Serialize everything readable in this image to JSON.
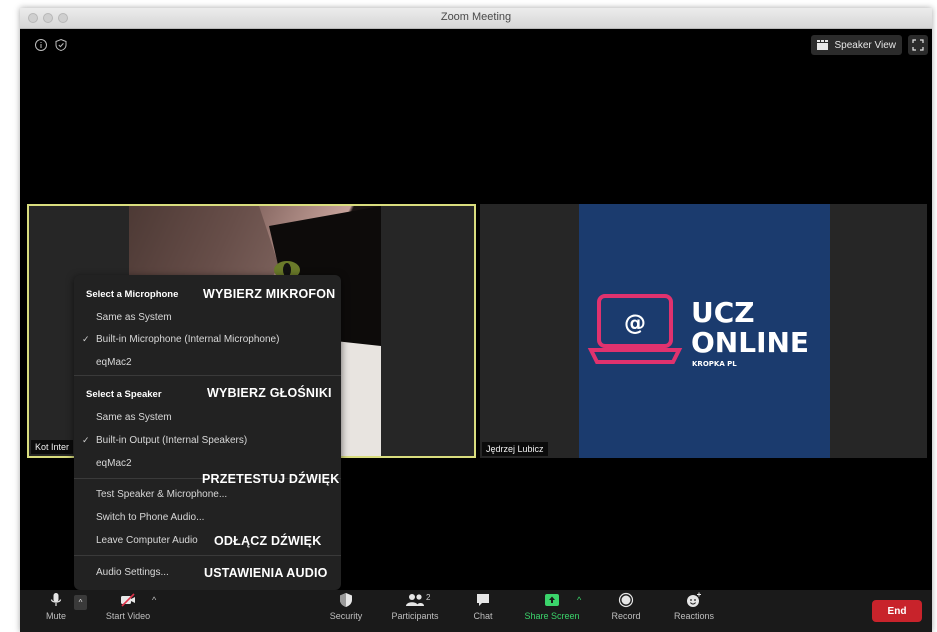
{
  "window": {
    "title": "Zoom Meeting"
  },
  "header": {
    "speaker_view_label": "Speaker View"
  },
  "tiles": [
    {
      "name": "Kot Inter"
    },
    {
      "name": "Jędrzej Lubicz"
    }
  ],
  "logo": {
    "line1": "UCZ",
    "line2": "ONLINE",
    "line3": "KROPKA PL",
    "symbol": "@"
  },
  "audio_menu": {
    "mic_heading": "Select a Microphone",
    "mic_items": [
      "Same as System",
      "Built-in Microphone (Internal Microphone)",
      "eqMac2"
    ],
    "speaker_heading": "Select a Speaker",
    "speaker_items": [
      "Same as System",
      "Built-in Output (Internal Speakers)",
      "eqMac2"
    ],
    "actions": [
      "Test Speaker & Microphone...",
      "Switch to Phone Audio...",
      "Leave Computer Audio"
    ],
    "settings": "Audio Settings..."
  },
  "annotations": {
    "mic": "WYBIERZ MIKROFON",
    "speaker": "WYBIERZ GŁOŚNIKI",
    "test": "PRZETESTUJ DŹWIĘK",
    "leave": "ODŁĄCZ DŹWIĘK",
    "settings": "USTAWIENIA AUDIO"
  },
  "toolbar": {
    "mute": "Mute",
    "start_video": "Start Video",
    "security": "Security",
    "participants": "Participants",
    "participants_count": "2",
    "chat": "Chat",
    "share_screen": "Share Screen",
    "record": "Record",
    "reactions": "Reactions",
    "end": "End"
  },
  "colors": {
    "share_green": "#3bd46b",
    "end_red": "#c8232b",
    "active_border": "#d9dd7e",
    "logo_blue": "#1b3b6e",
    "logo_pink": "#e0326e"
  }
}
